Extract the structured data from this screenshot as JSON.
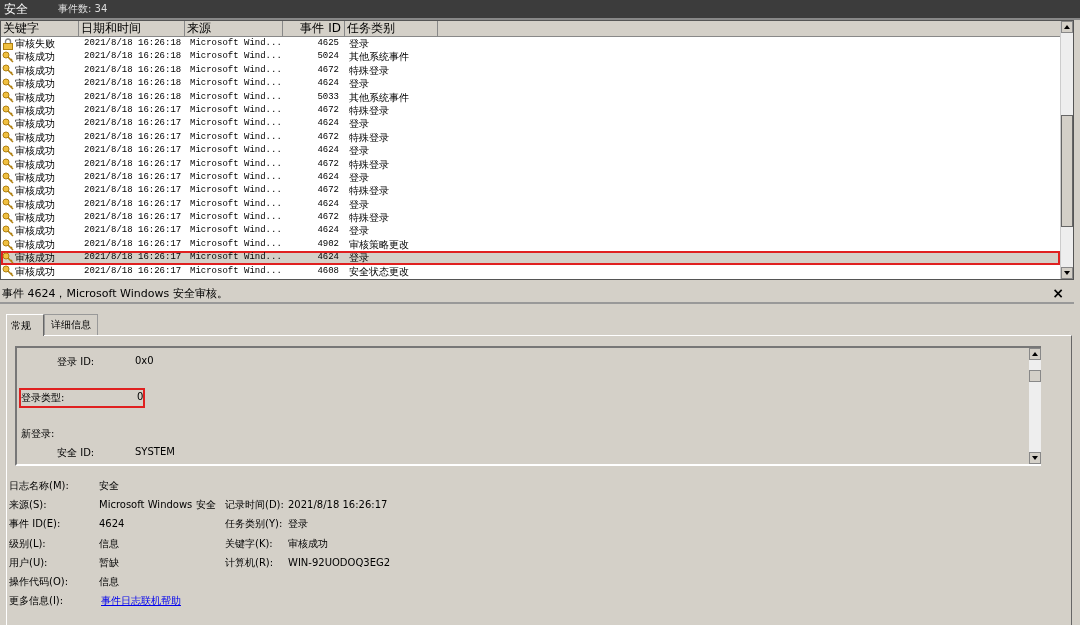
{
  "header": {
    "log_name": "安全",
    "event_count": "事件数: 34"
  },
  "table": {
    "columns": [
      "关键字",
      "日期和时间",
      "来源",
      "事件 ID",
      "任务类别"
    ],
    "rows": [
      {
        "kind": "failure",
        "keyword": "审核失败",
        "datetime": "2021/8/18 16:26:18",
        "source": "Microsoft Wind...",
        "event_id": "4625",
        "category": "登录",
        "selected": false,
        "highlighted": false
      },
      {
        "kind": "success",
        "keyword": "审核成功",
        "datetime": "2021/8/18 16:26:18",
        "source": "Microsoft Wind...",
        "event_id": "5024",
        "category": "其他系统事件",
        "selected": false,
        "highlighted": false
      },
      {
        "kind": "success",
        "keyword": "审核成功",
        "datetime": "2021/8/18 16:26:18",
        "source": "Microsoft Wind...",
        "event_id": "4672",
        "category": "特殊登录",
        "selected": false,
        "highlighted": false
      },
      {
        "kind": "success",
        "keyword": "审核成功",
        "datetime": "2021/8/18 16:26:18",
        "source": "Microsoft Wind...",
        "event_id": "4624",
        "category": "登录",
        "selected": false,
        "highlighted": false
      },
      {
        "kind": "success",
        "keyword": "审核成功",
        "datetime": "2021/8/18 16:26:18",
        "source": "Microsoft Wind...",
        "event_id": "5033",
        "category": "其他系统事件",
        "selected": false,
        "highlighted": false
      },
      {
        "kind": "success",
        "keyword": "审核成功",
        "datetime": "2021/8/18 16:26:17",
        "source": "Microsoft Wind...",
        "event_id": "4672",
        "category": "特殊登录",
        "selected": false,
        "highlighted": false
      },
      {
        "kind": "success",
        "keyword": "审核成功",
        "datetime": "2021/8/18 16:26:17",
        "source": "Microsoft Wind...",
        "event_id": "4624",
        "category": "登录",
        "selected": false,
        "highlighted": false
      },
      {
        "kind": "success",
        "keyword": "审核成功",
        "datetime": "2021/8/18 16:26:17",
        "source": "Microsoft Wind...",
        "event_id": "4672",
        "category": "特殊登录",
        "selected": false,
        "highlighted": false
      },
      {
        "kind": "success",
        "keyword": "审核成功",
        "datetime": "2021/8/18 16:26:17",
        "source": "Microsoft Wind...",
        "event_id": "4624",
        "category": "登录",
        "selected": false,
        "highlighted": false
      },
      {
        "kind": "success",
        "keyword": "审核成功",
        "datetime": "2021/8/18 16:26:17",
        "source": "Microsoft Wind...",
        "event_id": "4672",
        "category": "特殊登录",
        "selected": false,
        "highlighted": false
      },
      {
        "kind": "success",
        "keyword": "审核成功",
        "datetime": "2021/8/18 16:26:17",
        "source": "Microsoft Wind...",
        "event_id": "4624",
        "category": "登录",
        "selected": false,
        "highlighted": false
      },
      {
        "kind": "success",
        "keyword": "审核成功",
        "datetime": "2021/8/18 16:26:17",
        "source": "Microsoft Wind...",
        "event_id": "4672",
        "category": "特殊登录",
        "selected": false,
        "highlighted": false
      },
      {
        "kind": "success",
        "keyword": "审核成功",
        "datetime": "2021/8/18 16:26:17",
        "source": "Microsoft Wind...",
        "event_id": "4624",
        "category": "登录",
        "selected": false,
        "highlighted": false
      },
      {
        "kind": "success",
        "keyword": "审核成功",
        "datetime": "2021/8/18 16:26:17",
        "source": "Microsoft Wind...",
        "event_id": "4672",
        "category": "特殊登录",
        "selected": false,
        "highlighted": false
      },
      {
        "kind": "success",
        "keyword": "审核成功",
        "datetime": "2021/8/18 16:26:17",
        "source": "Microsoft Wind...",
        "event_id": "4624",
        "category": "登录",
        "selected": false,
        "highlighted": false
      },
      {
        "kind": "success",
        "keyword": "审核成功",
        "datetime": "2021/8/18 16:26:17",
        "source": "Microsoft Wind...",
        "event_id": "4902",
        "category": "审核策略更改",
        "selected": false,
        "highlighted": false
      },
      {
        "kind": "success",
        "keyword": "审核成功",
        "datetime": "2021/8/18 16:26:17",
        "source": "Microsoft Wind...",
        "event_id": "4624",
        "category": "登录",
        "selected": true,
        "highlighted": true
      },
      {
        "kind": "success",
        "keyword": "审核成功",
        "datetime": "2021/8/18 16:26:17",
        "source": "Microsoft Wind...",
        "event_id": "4608",
        "category": "安全状态更改",
        "selected": false,
        "highlighted": false
      }
    ]
  },
  "detail": {
    "title": "事件 4624，Microsoft Windows 安全审核。",
    "close": "×",
    "tabs": [
      {
        "label": "常规",
        "selected": true
      },
      {
        "label": "详细信息",
        "selected": false
      }
    ],
    "description": [
      {
        "children": [
          {
            "label": "登录 ID:",
            "value": "0x0",
            "highlighted": false
          }
        ]
      },
      {
        "label": "登录类型:",
        "value": "0",
        "highlighted": true
      },
      {
        "label": "新登录:",
        "highlighted": false,
        "children": [
          {
            "label": "安全 ID:",
            "value": "SYSTEM",
            "highlighted": false
          }
        ]
      }
    ],
    "properties": [
      [
        {
          "label": "日志名称(M):",
          "value": "安全"
        }
      ],
      [
        {
          "label": "来源(S):",
          "value": "Microsoft Windows 安全"
        },
        {
          "label": "记录时间(D):",
          "value": "2021/8/18 16:26:17"
        }
      ],
      [
        {
          "label": "事件 ID(E):",
          "value": "4624"
        },
        {
          "label": "任务类别(Y):",
          "value": "登录"
        }
      ],
      [
        {
          "label": "级别(L):",
          "value": "信息"
        },
        {
          "label": "关键字(K):",
          "value": "审核成功"
        }
      ],
      [
        {
          "label": "用户(U):",
          "value": "暂缺"
        },
        {
          "label": "计算机(R):",
          "value": "WIN-92UODOQ3EG2"
        }
      ],
      [
        {
          "label": "操作代码(O):",
          "value": "信息"
        }
      ],
      [
        {
          "label": "更多信息(I):",
          "value": "事件日志联机帮助",
          "kind": "link"
        }
      ]
    ]
  }
}
